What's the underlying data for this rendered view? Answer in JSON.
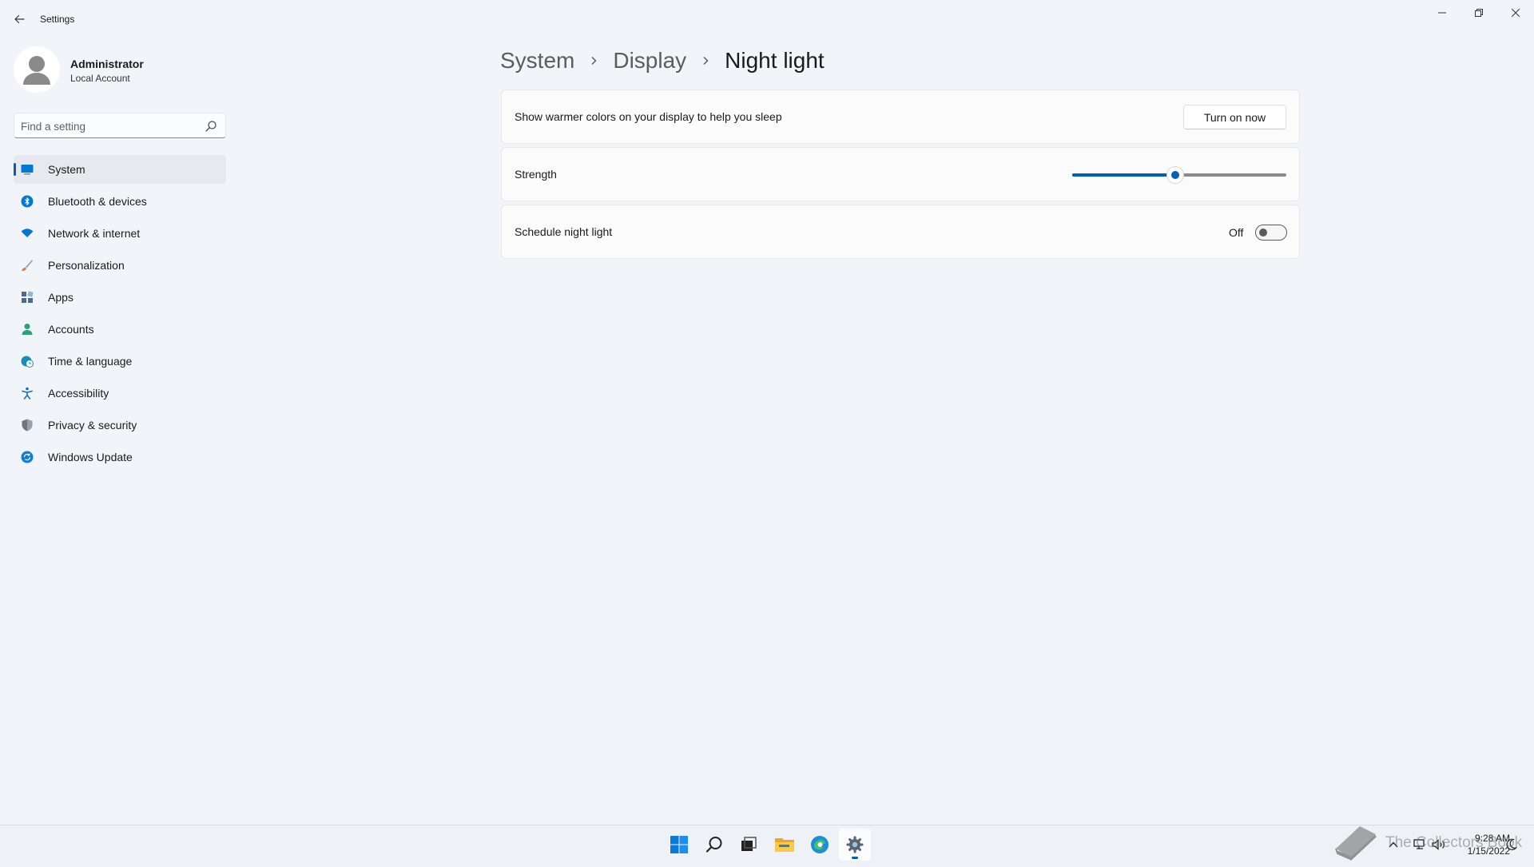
{
  "window": {
    "title": "Settings"
  },
  "user": {
    "name": "Administrator",
    "account_type": "Local Account"
  },
  "search": {
    "placeholder": "Find a setting"
  },
  "sidebar": {
    "items": [
      {
        "label": "System",
        "icon": "system-icon",
        "color": "#0078d4",
        "active": true
      },
      {
        "label": "Bluetooth & devices",
        "icon": "bluetooth-icon",
        "color": "#0078d4"
      },
      {
        "label": "Network & internet",
        "icon": "wifi-icon",
        "color": "#0078d4"
      },
      {
        "label": "Personalization",
        "icon": "brush-icon",
        "color": "#e3762b"
      },
      {
        "label": "Apps",
        "icon": "apps-icon",
        "color": "#4a6b91"
      },
      {
        "label": "Accounts",
        "icon": "person-icon",
        "color": "#2aa37a"
      },
      {
        "label": "Time & language",
        "icon": "globe-clock-icon",
        "color": "#1a8bbd"
      },
      {
        "label": "Accessibility",
        "icon": "accessibility-icon",
        "color": "#1b6fc0"
      },
      {
        "label": "Privacy & security",
        "icon": "shield-icon",
        "color": "#6d7580"
      },
      {
        "label": "Windows Update",
        "icon": "update-icon",
        "color": "#0f7ed8"
      }
    ]
  },
  "breadcrumb": {
    "items": [
      "System",
      "Display",
      "Night light"
    ]
  },
  "settings": {
    "turn_on": {
      "label": "Show warmer colors on your display to help you sleep",
      "button_label": "Turn on now"
    },
    "strength": {
      "label": "Strength",
      "value_percent": 48
    },
    "schedule": {
      "label": "Schedule night light",
      "state_text": "Off"
    }
  },
  "taskbar": {
    "apps": [
      "windows-start-icon",
      "search-icon",
      "task-view-icon",
      "file-explorer-icon",
      "edge-icon",
      "settings-gear-icon"
    ],
    "active_app": "settings-gear-icon",
    "tray": [
      "chevron-up-icon",
      "network-icon",
      "volume-icon",
      "notification-icon"
    ],
    "time": "9:28 AM",
    "date": "1/15/2022"
  },
  "watermark": {
    "text": "The Collectors Book",
    "icon": "book-icon"
  },
  "colors": {
    "accent": "#005fb8",
    "background": "#f1f4f9",
    "card": "#fbfbfc"
  }
}
